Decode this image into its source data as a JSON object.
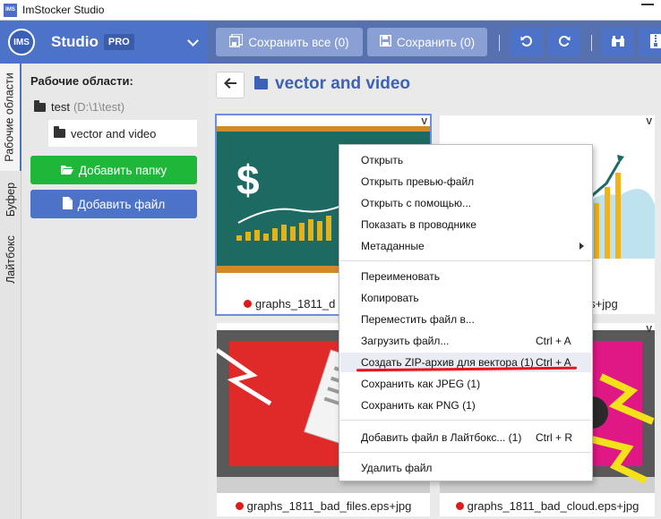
{
  "window": {
    "title": "ImStocker Studio",
    "icon_text": "IMS"
  },
  "brand": {
    "logo_text": "IMS",
    "name": "Studio",
    "badge": "PRO"
  },
  "toolbar": {
    "save_all_label": "Сохранить все (0)",
    "save_label": "Сохранить (0)"
  },
  "vtabs": [
    "Рабочие области",
    "Буфер",
    "Лайтбокс"
  ],
  "sidebar": {
    "heading": "Рабочие области:",
    "workspace_name": "test",
    "workspace_path": "(D:\\1\\test)",
    "folder": "vector and video",
    "add_folder": "Добавить папку",
    "add_file": "Добавить файл"
  },
  "main": {
    "breadcrumb": "vector and video",
    "files": [
      {
        "name": "graphs_1811_d",
        "badge": "V"
      },
      {
        "name": "ps+jpg",
        "badge": "V"
      },
      {
        "name": "graphs_1811_bad_files.eps+jpg",
        "badge": "V"
      },
      {
        "name": "graphs_1811_bad_cloud.eps+jpg",
        "badge": "V"
      }
    ]
  },
  "context_menu": {
    "items": [
      {
        "label": "Открыть",
        "shortcut": ""
      },
      {
        "label": "Открыть превью-файл",
        "shortcut": ""
      },
      {
        "label": "Открыть с помощью...",
        "shortcut": ""
      },
      {
        "label": "Показать в проводнике",
        "shortcut": ""
      },
      {
        "label": "Метаданные",
        "shortcut": ""
      },
      {
        "label": "Переименовать",
        "shortcut": ""
      },
      {
        "label": "Копировать",
        "shortcut": ""
      },
      {
        "label": "Переместить файл в...",
        "shortcut": ""
      },
      {
        "label": "Загрузить файл...",
        "shortcut": "Ctrl + A"
      },
      {
        "label": "Создать ZIP-архив для вектора (1)",
        "shortcut": "Ctrl + A"
      },
      {
        "label": "Сохранить как JPEG (1)",
        "shortcut": ""
      },
      {
        "label": "Сохранить как PNG (1)",
        "shortcut": ""
      },
      {
        "label": "Добавить файл в Лайтбокс... (1)",
        "shortcut": "Ctrl + R"
      },
      {
        "label": "Удалить файл",
        "shortcut": ""
      }
    ]
  },
  "colors": {
    "accent": "#4d73c8",
    "green": "#1fb73a",
    "status_dot": "#e21a1a",
    "annotation": "#e8141d"
  }
}
